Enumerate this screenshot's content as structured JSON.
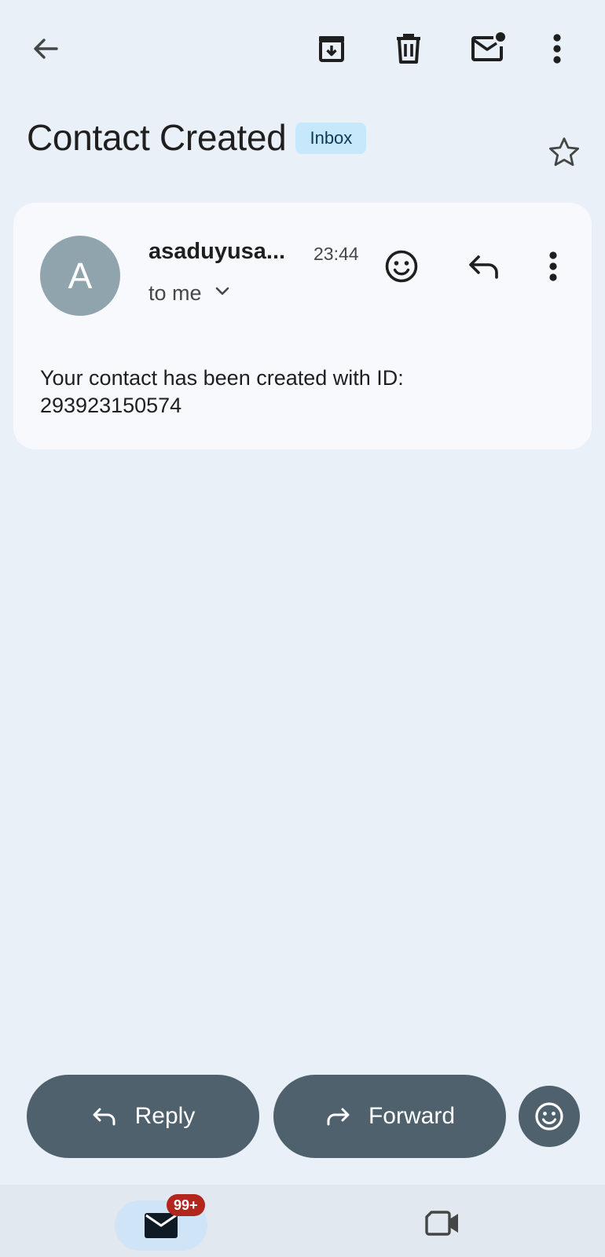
{
  "toolbar": {
    "icons": [
      "back-arrow-icon",
      "archive-icon",
      "delete-icon",
      "mark-unread-icon",
      "more-vert-icon"
    ]
  },
  "email": {
    "subject": "Contact Created",
    "label": "Inbox",
    "sender_initial": "A",
    "sender": "asaduyusa...",
    "time": "23:44",
    "recipient": "to me",
    "body_lines": [
      "Your contact has been created with ID:",
      "293923150574"
    ]
  },
  "actions": {
    "reply_label": "Reply",
    "forward_label": "Forward"
  },
  "bottom_nav": {
    "mail_badge": "99+"
  },
  "colors": {
    "background": "#eaf0f8",
    "card": "#f7f9fd",
    "label_chip": "#c7e7fb",
    "action_button": "#4f616d",
    "badge": "#b3261e",
    "avatar": "#8fa4ad"
  }
}
